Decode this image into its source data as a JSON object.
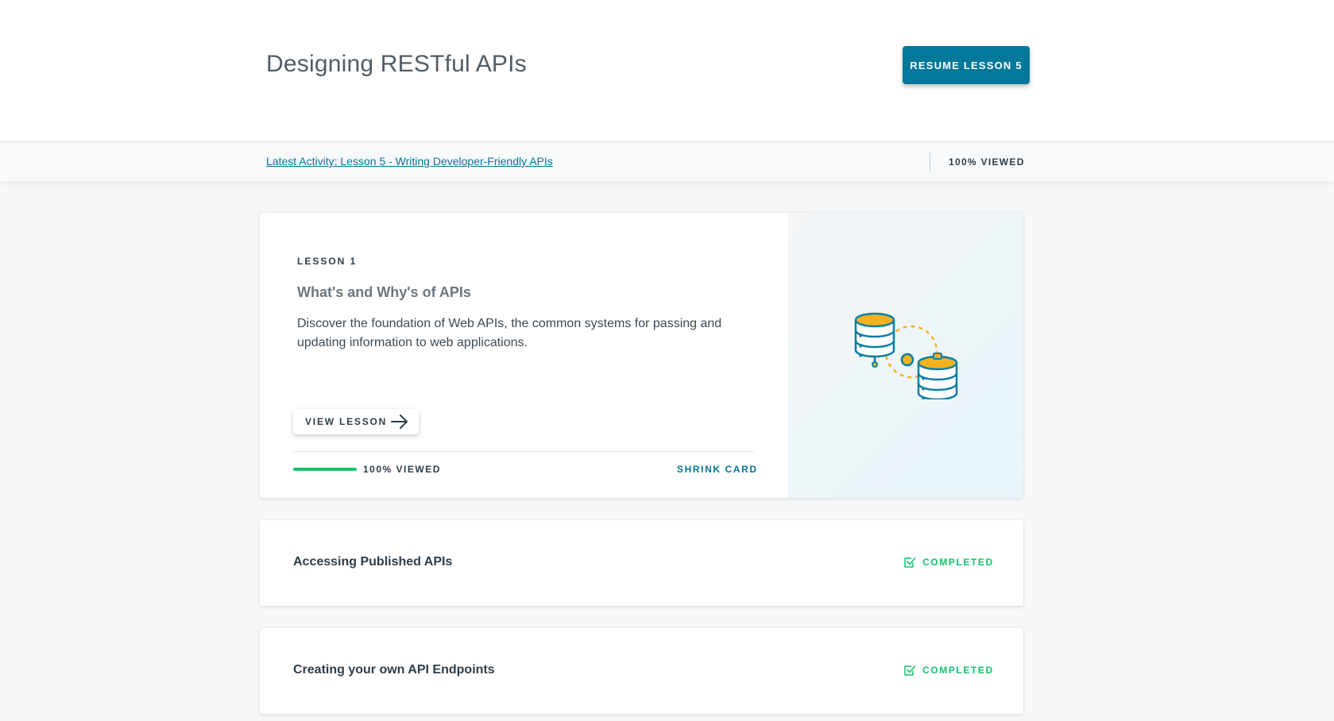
{
  "header": {
    "course_title": "Designing RESTful APIs",
    "resume_label": "RESUME LESSON 5",
    "accent_color": "#02789a"
  },
  "activity": {
    "link_text": "Latest Activity: Lesson 5 - Writing Developer-Friendly APIs",
    "viewed_label": "100% VIEWED"
  },
  "lessons": [
    {
      "label": "LESSON 1",
      "title": "What's and Why's of APIs",
      "description": "Discover the foundation of Web APIs, the common systems for passing and updating information to web applications.",
      "view_label": "VIEW LESSON",
      "progress": 1.0,
      "progress_label": "100% VIEWED",
      "shrink_label": "SHRINK CARD",
      "illustration": "database-sync-icon"
    },
    {
      "title": "Accessing Published APIs",
      "status_label": "COMPLETED",
      "status_icon": "checkbox-checked-icon"
    },
    {
      "title": "Creating your own API Endpoints",
      "status_label": "COMPLETED",
      "status_icon": "checkbox-checked-icon"
    }
  ],
  "colors": {
    "progress": "#15c26b",
    "completed": "#15c26b",
    "db_stroke": "#0a7fa3",
    "db_fill": "#f5b120"
  }
}
